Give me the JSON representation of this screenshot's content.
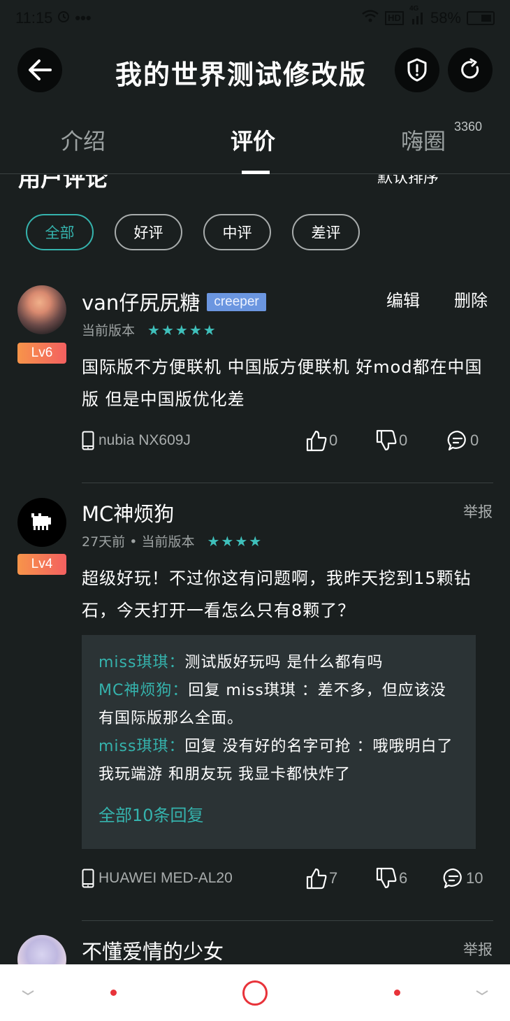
{
  "status_bar": {
    "time": "11:15",
    "battery": "58%",
    "network": "4G",
    "hd": "HD"
  },
  "header": {
    "title": "我的世界测试修改版",
    "back_icon": "arrow-left-icon",
    "report_icon": "shield-alert-icon",
    "refresh_icon": "refresh-icon"
  },
  "tabs": [
    {
      "label": "介绍",
      "active": false
    },
    {
      "label": "评价",
      "active": true
    },
    {
      "label": "嗨圈",
      "badge": "3360",
      "active": false
    }
  ],
  "section": {
    "title": "用户评论",
    "sort_label": "默认排序"
  },
  "filters": [
    {
      "label": "全部",
      "active": true
    },
    {
      "label": "好评",
      "active": false
    },
    {
      "label": "中评",
      "active": false
    },
    {
      "label": "差评",
      "active": false
    }
  ],
  "colors": {
    "accent": "#35b3ad",
    "background": "#1a1f1f",
    "star": "#3fc0bb",
    "tag": "#6b96e0",
    "level_gradient_start": "#f7944a",
    "level_gradient_end": "#f36060",
    "nav_red": "#e8333a"
  },
  "reviews": [
    {
      "username": "van仔尻尻糖",
      "tag": "creeper",
      "level": "Lv6",
      "meta": "当前版本",
      "rating": 5,
      "actions": [
        "编辑",
        "删除"
      ],
      "text": "国际版不方便联机 中国版方便联机 好mod都在中国版 但是中国版优化差",
      "device": "nubia  NX609J",
      "likes": "0",
      "dislikes": "0",
      "comments": "0"
    },
    {
      "username": "MC神烦狗",
      "level": "Lv4",
      "meta": "27天前 • 当前版本",
      "rating": 4,
      "report": "举报",
      "text": "超级好玩！不过你这有问题啊，我昨天挖到15颗钻石，今天打开一看怎么只有8颗了？",
      "replies": [
        {
          "author": "miss琪琪：",
          "text": "测试版好玩吗 是什么都有吗"
        },
        {
          "author": "MC神烦狗：",
          "text": "回复 miss琪琪 ：差不多，但应该没有国际版那么全面。"
        },
        {
          "author": "miss琪琪：",
          "text": "回复 没有好的名字可抢 ：哦哦明白了 我玩端游 和朋友玩 我显卡都快炸了"
        }
      ],
      "all_replies": "全部10条回复",
      "device": "HUAWEI  MED-AL20",
      "likes": "7",
      "dislikes": "6",
      "comments": "10"
    },
    {
      "username": "不懂爱情的少女",
      "report": "举报"
    }
  ]
}
